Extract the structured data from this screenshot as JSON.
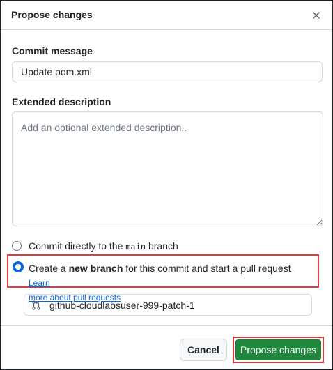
{
  "dialog": {
    "title": "Propose changes"
  },
  "commit_message": {
    "label": "Commit message",
    "value": "Update pom.xml"
  },
  "extended_description": {
    "label": "Extended description",
    "placeholder": "Add an optional extended description.."
  },
  "options": {
    "direct": {
      "prefix": "Commit directly to the ",
      "branch": "main",
      "suffix": " branch"
    },
    "new_branch": {
      "prefix": "Create a ",
      "bold": "new branch",
      "suffix": " for this commit and start a pull request ",
      "link_line1": "Learn",
      "link_line2": "more about pull requests"
    }
  },
  "branch_name": {
    "value": "github-cloudlabsuser-999-patch-1"
  },
  "footer": {
    "cancel_label": "Cancel",
    "propose_label": "Propose changes"
  },
  "colors": {
    "primary": "#1f883d",
    "accent": "#0969da",
    "highlight": "#e0393e"
  }
}
